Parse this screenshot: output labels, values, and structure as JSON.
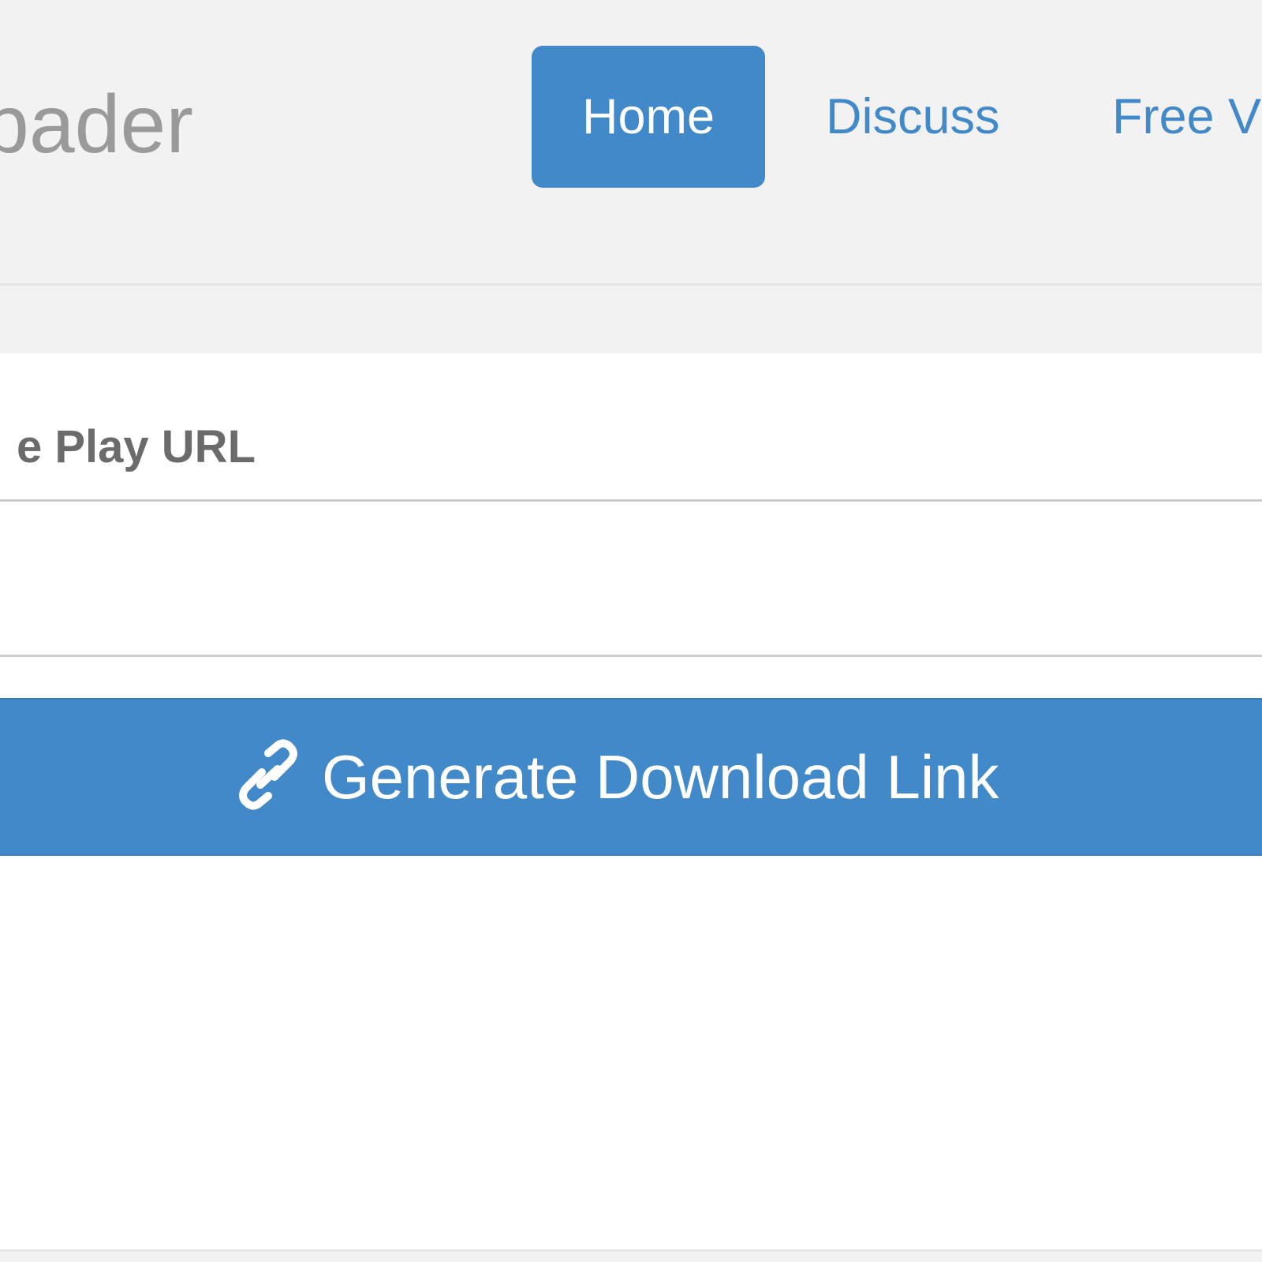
{
  "header": {
    "brand_text": "bader",
    "nav": [
      {
        "label": "Home",
        "active": true
      },
      {
        "label": "Discuss",
        "active": false
      },
      {
        "label": "Free V",
        "active": false
      }
    ]
  },
  "form": {
    "url_label": "e Play URL",
    "url_input_value": "",
    "generate_button_label": "Generate Download Link",
    "generate_button_icon": "link-icon"
  },
  "colors": {
    "accent": "#4289c9",
    "header_bg": "#f2f2f2",
    "brand_text": "#9a9a9a",
    "label_text": "#6b6b6b"
  }
}
